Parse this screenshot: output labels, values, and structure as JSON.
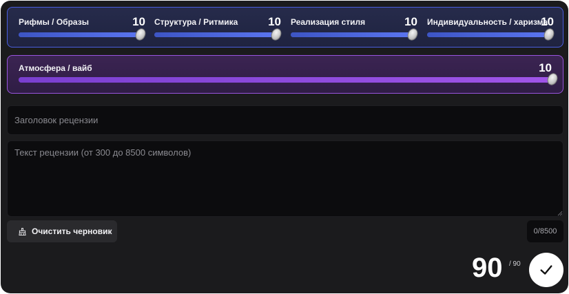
{
  "criteria": [
    {
      "label": "Рифмы / Образы",
      "value": "10",
      "fraction": 1.0
    },
    {
      "label": "Структура / Ритмика",
      "value": "10",
      "fraction": 1.0
    },
    {
      "label": "Реализация стиля",
      "value": "10",
      "fraction": 1.0
    },
    {
      "label": "Индивидуальность / харизма",
      "value": "10",
      "fraction": 1.0
    }
  ],
  "atmosphere": {
    "label": "Атмосфера / вайб",
    "value": "10",
    "fraction": 1.0
  },
  "review": {
    "title_placeholder": "Заголовок рецензии",
    "title_value": "",
    "text_placeholder": "Текст рецензии (от 300 до 8500 символов)",
    "text_value": ""
  },
  "actions": {
    "clear_label": "Очистить черновик",
    "counter": "0/8500"
  },
  "score": {
    "total": "90",
    "max": "/ 90"
  },
  "colors": {
    "background": "#1b1b1d",
    "blue_accent": "#4a5ee0",
    "purple_accent": "#9a55e0"
  },
  "icons": {
    "slider_thumb": "silver-coin-thumb",
    "clear": "broom-icon",
    "submit": "checkmark-icon",
    "resize": "resize-grip-icon"
  }
}
